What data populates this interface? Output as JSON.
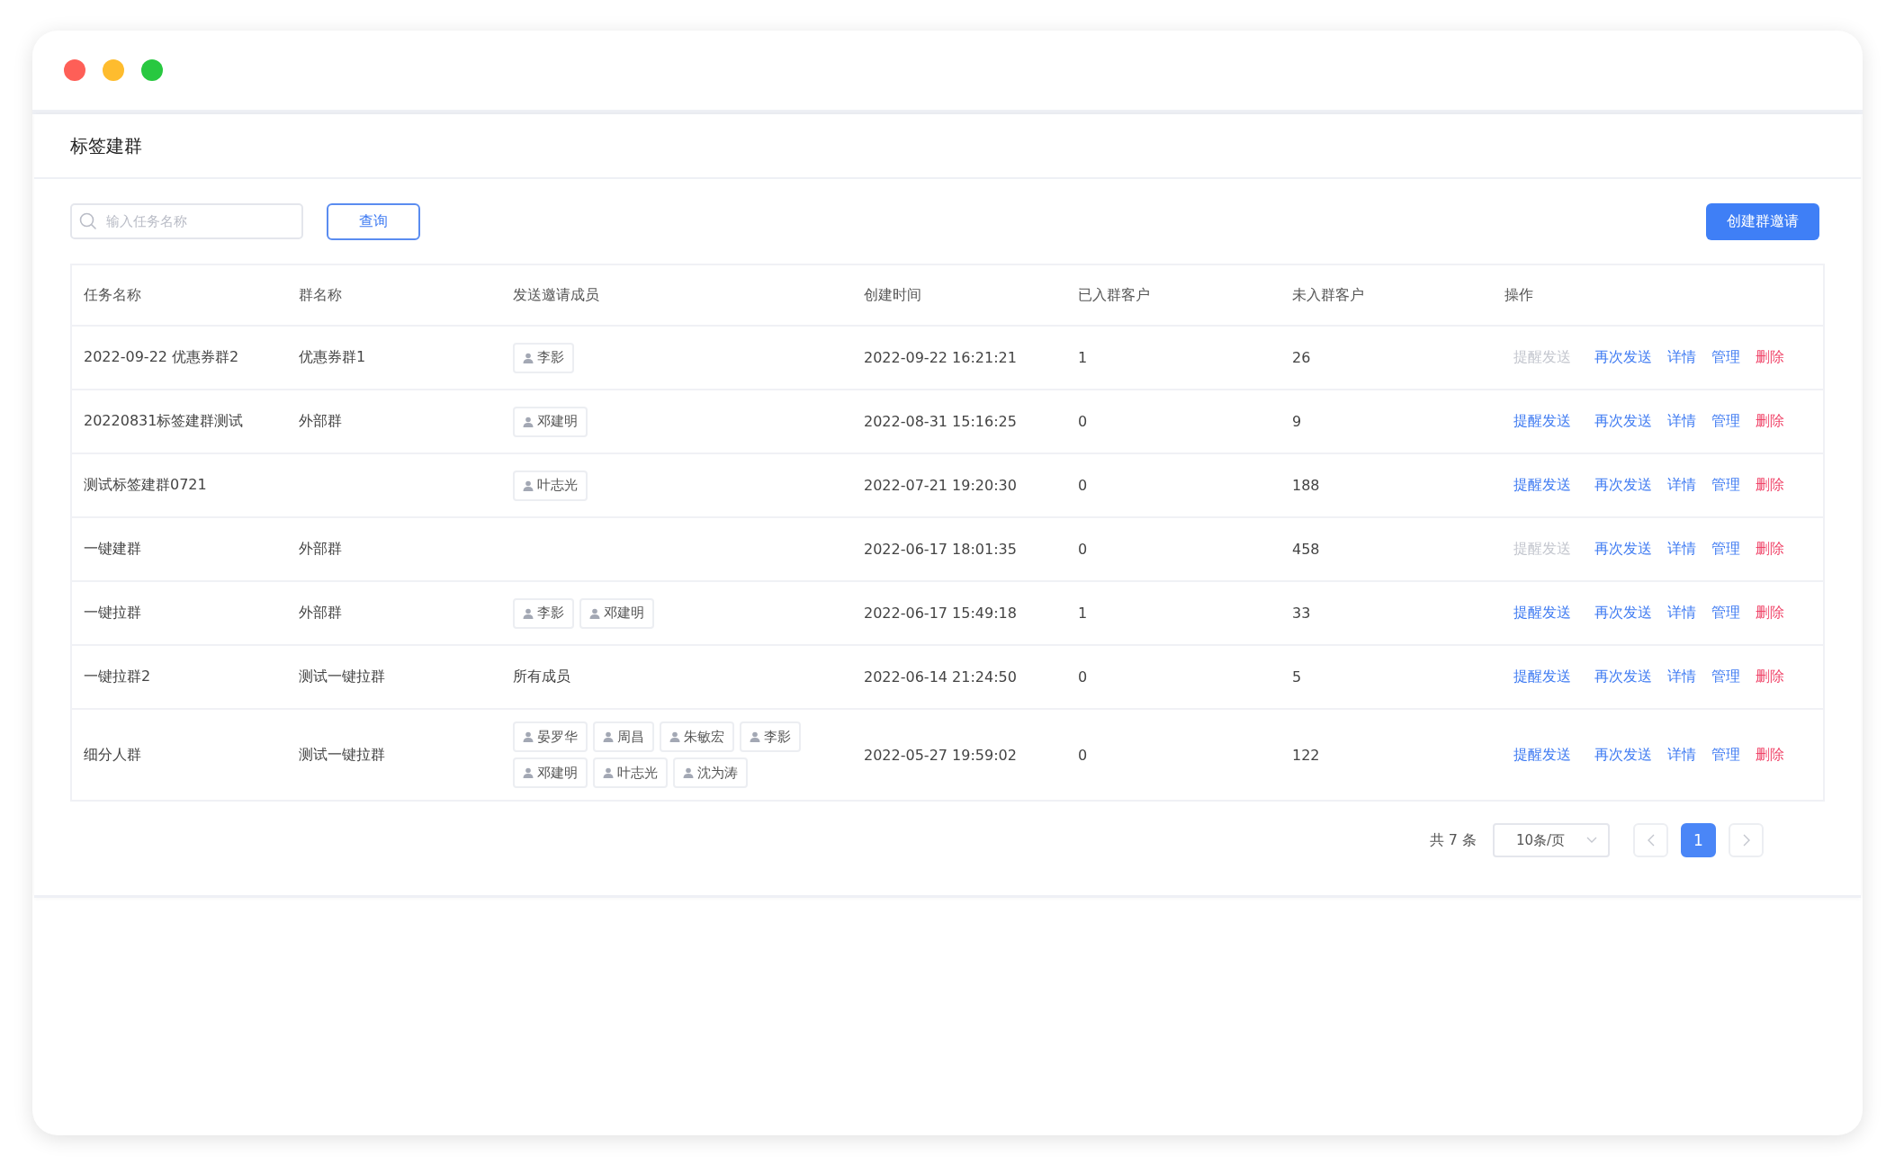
{
  "page_title": "标签建群",
  "search": {
    "placeholder": "输入任务名称"
  },
  "query_button": "查询",
  "create_button": "创建群邀请",
  "table": {
    "columns": [
      "任务名称",
      "群名称",
      "发送邀请成员",
      "创建时间",
      "已入群客户",
      "未入群客户",
      "操作"
    ],
    "rows": [
      {
        "task": "2022-09-22 优惠券群2",
        "group": "优惠券群1",
        "members": [
          "李影"
        ],
        "created": "2022-09-22 16:21:21",
        "joined": "1",
        "not_joined": "26",
        "actions": [
          {
            "label": "提醒发送",
            "kind": "link",
            "disabled": true
          },
          {
            "label": "再次发送",
            "kind": "link",
            "disabled": false
          },
          {
            "label": "详情",
            "kind": "link",
            "disabled": false
          },
          {
            "label": "管理",
            "kind": "link",
            "disabled": false
          },
          {
            "label": "删除",
            "kind": "danger",
            "disabled": false
          }
        ]
      },
      {
        "task": "20220831标签建群测试",
        "group": "外部群",
        "members": [
          "邓建明"
        ],
        "created": "2022-08-31 15:16:25",
        "joined": "0",
        "not_joined": "9",
        "actions": [
          {
            "label": "提醒发送",
            "kind": "link",
            "disabled": false
          },
          {
            "label": "再次发送",
            "kind": "link",
            "disabled": false
          },
          {
            "label": "详情",
            "kind": "link",
            "disabled": false
          },
          {
            "label": "管理",
            "kind": "link",
            "disabled": false
          },
          {
            "label": "删除",
            "kind": "danger",
            "disabled": false
          }
        ]
      },
      {
        "task": "测试标签建群0721",
        "members": [
          "叶志光"
        ],
        "created": "2022-07-21 19:20:30",
        "joined": "0",
        "not_joined": "188",
        "actions": [
          {
            "label": "提醒发送",
            "kind": "link",
            "disabled": false
          },
          {
            "label": "再次发送",
            "kind": "link",
            "disabled": false
          },
          {
            "label": "详情",
            "kind": "link",
            "disabled": false
          },
          {
            "label": "管理",
            "kind": "link",
            "disabled": false
          },
          {
            "label": "删除",
            "kind": "danger",
            "disabled": false
          }
        ]
      },
      {
        "task": "一键建群",
        "group": "外部群",
        "created": "2022-06-17 18:01:35",
        "joined": "0",
        "not_joined": "458",
        "actions": [
          {
            "label": "提醒发送",
            "kind": "link",
            "disabled": true
          },
          {
            "label": "再次发送",
            "kind": "link",
            "disabled": false
          },
          {
            "label": "详情",
            "kind": "link",
            "disabled": false
          },
          {
            "label": "管理",
            "kind": "link",
            "disabled": false
          },
          {
            "label": "删除",
            "kind": "danger",
            "disabled": false
          }
        ]
      },
      {
        "task": "一键拉群",
        "group": "外部群",
        "members": [
          "李影",
          "邓建明"
        ],
        "created": "2022-06-17 15:49:18",
        "joined": "1",
        "not_joined": "33",
        "actions": [
          {
            "label": "提醒发送",
            "kind": "link",
            "disabled": false
          },
          {
            "label": "再次发送",
            "kind": "link",
            "disabled": false
          },
          {
            "label": "详情",
            "kind": "link",
            "disabled": false
          },
          {
            "label": "管理",
            "kind": "link",
            "disabled": false
          },
          {
            "label": "删除",
            "kind": "danger",
            "disabled": false
          }
        ]
      },
      {
        "task": "一键拉群2",
        "group": "测试一键拉群",
        "members_text": "所有成员",
        "created": "2022-06-14 21:24:50",
        "joined": "0",
        "not_joined": "5",
        "actions": [
          {
            "label": "提醒发送",
            "kind": "link",
            "disabled": false
          },
          {
            "label": "再次发送",
            "kind": "link",
            "disabled": false
          },
          {
            "label": "详情",
            "kind": "link",
            "disabled": false
          },
          {
            "label": "管理",
            "kind": "link",
            "disabled": false
          },
          {
            "label": "删除",
            "kind": "danger",
            "disabled": false
          }
        ]
      },
      {
        "task": "细分人群",
        "group": "测试一键拉群",
        "members": [
          "晏罗华",
          "周昌",
          "朱敏宏",
          "李影",
          "邓建明",
          "叶志光",
          "沈为涛"
        ],
        "created": "2022-05-27 19:59:02",
        "joined": "0",
        "not_joined": "122",
        "actions": [
          {
            "label": "提醒发送",
            "kind": "link",
            "disabled": false
          },
          {
            "label": "再次发送",
            "kind": "link",
            "disabled": false
          },
          {
            "label": "详情",
            "kind": "link",
            "disabled": false
          },
          {
            "label": "管理",
            "kind": "link",
            "disabled": false
          },
          {
            "label": "删除",
            "kind": "danger",
            "disabled": false
          }
        ]
      }
    ]
  },
  "pagination": {
    "total": "共 7 条",
    "page_size": "10条/页",
    "pages": [
      {
        "label": "1",
        "selected": true
      }
    ]
  }
}
